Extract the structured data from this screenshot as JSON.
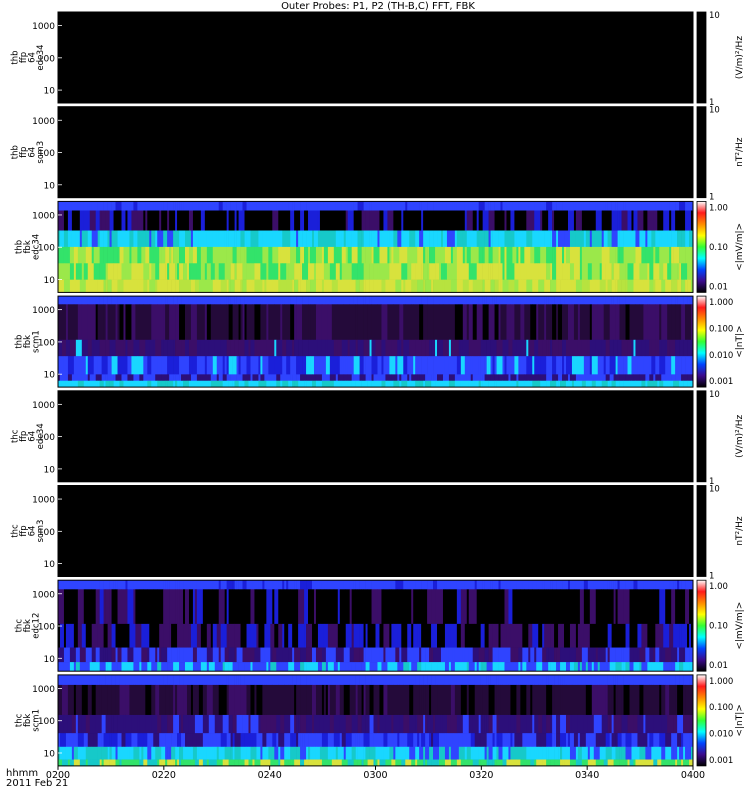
{
  "chart_data": {
    "type": "heatmap",
    "title": "Outer Probes: P1, P2 (TH-B,C) FFT, FBK",
    "x_axis": {
      "label_line1": "hhmm",
      "label_line2": "2011 Feb 21",
      "range": [
        "0200",
        "0400"
      ],
      "ticks": [
        "0200",
        "0220",
        "0240",
        "0300",
        "0320",
        "0340",
        "0400"
      ]
    },
    "y_ticks": [
      "10",
      "100",
      "1000"
    ],
    "panels": [
      {
        "label": [
          "thb",
          "ffp",
          "64",
          "edc34"
        ],
        "colorbar_unit": "(V/m)²/Hz",
        "colorbar_ticks": [
          "10",
          "1"
        ],
        "colorbar": "black",
        "pattern": "empty"
      },
      {
        "label": [
          "thb",
          "ffp",
          "64",
          "scm3"
        ],
        "colorbar_unit": "nT²/Hz",
        "colorbar_ticks": [
          "10",
          "1"
        ],
        "colorbar": "black",
        "pattern": "empty"
      },
      {
        "label": [
          "thb",
          "fbk",
          "edc34"
        ],
        "colorbar_unit": "<|mV/m|>",
        "colorbar_ticks": [
          "1.00",
          "0.10",
          "0.01"
        ],
        "colorbar": "rainbow",
        "pattern": "fbk_edc_b"
      },
      {
        "label": [
          "thb",
          "fbk",
          "scm1"
        ],
        "colorbar_unit": "<|nT|>",
        "colorbar_ticks": [
          "1.000",
          "0.100",
          "0.010",
          "0.001"
        ],
        "colorbar": "rainbow",
        "pattern": "fbk_scm_b"
      },
      {
        "label": [
          "thc",
          "ffp",
          "64",
          "edc34"
        ],
        "colorbar_unit": "(V/m)²/Hz",
        "colorbar_ticks": [
          "10",
          "1"
        ],
        "colorbar": "black",
        "pattern": "empty"
      },
      {
        "label": [
          "thc",
          "ffp",
          "64",
          "scm3"
        ],
        "colorbar_unit": "nT²/Hz",
        "colorbar_ticks": [
          "10",
          "1"
        ],
        "colorbar": "black",
        "pattern": "empty"
      },
      {
        "label": [
          "thc",
          "fbk",
          "edc12"
        ],
        "colorbar_unit": "<|mV/m|>",
        "colorbar_ticks": [
          "1.00",
          "0.10",
          "0.01"
        ],
        "colorbar": "rainbow",
        "pattern": "fbk_edc_c"
      },
      {
        "label": [
          "thc",
          "fbk",
          "scm1"
        ],
        "colorbar_unit": "<|nT|>",
        "colorbar_ticks": [
          "1.000",
          "0.100",
          "0.010",
          "0.001"
        ],
        "colorbar": "rainbow",
        "pattern": "fbk_scm_c"
      }
    ]
  }
}
